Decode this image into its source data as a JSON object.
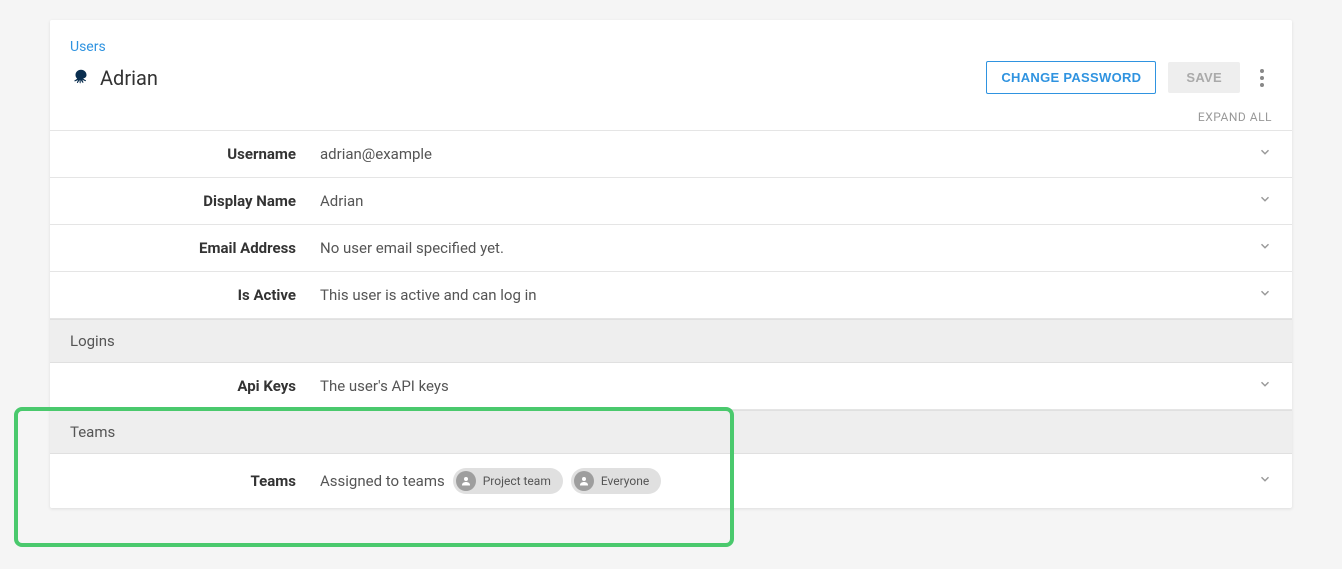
{
  "breadcrumb": "Users",
  "page_title": "Adrian",
  "buttons": {
    "change_password": "CHANGE PASSWORD",
    "save": "SAVE"
  },
  "expand_all": "EXPAND ALL",
  "fields": {
    "username": {
      "label": "Username",
      "value": "adrian@example"
    },
    "display_name": {
      "label": "Display Name",
      "value": "Adrian"
    },
    "email": {
      "label": "Email Address",
      "value": "No user email specified yet."
    },
    "is_active": {
      "label": "Is Active",
      "value": "This user is active and can log in"
    },
    "api_keys": {
      "label": "Api Keys",
      "value": "The user's API keys"
    },
    "teams": {
      "label": "Teams",
      "value": "Assigned to teams"
    }
  },
  "sections": {
    "logins": "Logins",
    "teams": "Teams"
  },
  "team_chips": [
    "Project team",
    "Everyone"
  ]
}
